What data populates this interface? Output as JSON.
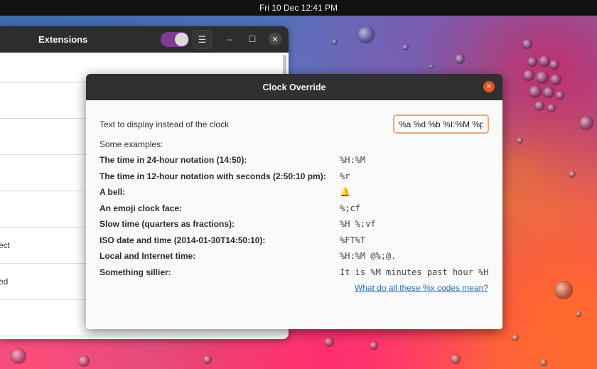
{
  "topbar": {
    "clock": "Fri 10 Dec 12:41 PM"
  },
  "extensions_window": {
    "title": "Extensions",
    "rows": [
      "",
      "",
      "",
      "",
      "",
      "ect",
      "ed",
      ""
    ]
  },
  "dialog": {
    "title": "Clock Override",
    "field_label": "Text to display instead of the clock",
    "field_value": "%a %d %b %I:%M %p",
    "examples_heading": "Some examples:",
    "examples": [
      {
        "label": "The time in 24-hour notation (14:50):",
        "code": "%H:%M"
      },
      {
        "label": "The time in 12-hour notation with seconds (2:50:10 pm):",
        "code": "%r"
      },
      {
        "label": "A bell:",
        "code": ""
      },
      {
        "label": "An emoji clock face:",
        "code": "%;cf"
      },
      {
        "label": "Slow time (quarters as fractions):",
        "code": "%H %;vf"
      },
      {
        "label": "ISO date and time (2014-01-30T14:50:10):",
        "code": "%FT%T"
      },
      {
        "label": "Local and Internet time:",
        "code": "%H:%M @%;@."
      },
      {
        "label": "Something sillier:",
        "code": "It is %M minutes past hour %H"
      }
    ],
    "help_link": "What do all these %x codes mean?"
  },
  "colors": {
    "accent": "#e95420",
    "toggle": "#7e3b94",
    "link": "#2c6fb5"
  }
}
